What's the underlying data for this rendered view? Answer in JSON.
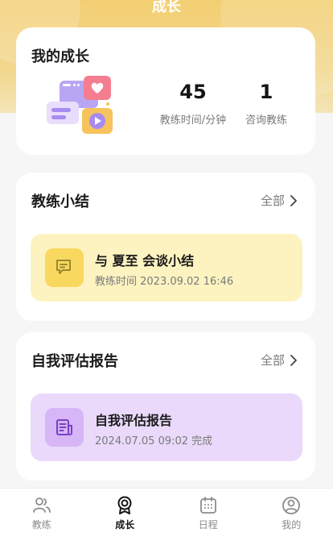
{
  "header": {
    "title": "成长"
  },
  "growth": {
    "title": "我的成长",
    "stats": [
      {
        "value": "45",
        "label": "教练时间/分钟"
      },
      {
        "value": "1",
        "label": "咨询教练"
      }
    ]
  },
  "summary": {
    "title": "教练小结",
    "view_all": "全部",
    "item": {
      "title": "与 夏至 会谈小结",
      "subtitle": "教练时间 2023.09.02 16:46"
    }
  },
  "report": {
    "title": "自我评估报告",
    "view_all": "全部",
    "item": {
      "title": "自我评估报告",
      "subtitle": "2024.07.05 09:02 完成"
    }
  },
  "tabbar": {
    "items": [
      {
        "label": "教练",
        "icon": "people-icon",
        "active": false
      },
      {
        "label": "成长",
        "icon": "growth-icon",
        "active": true
      },
      {
        "label": "日程",
        "icon": "calendar-icon",
        "active": false
      },
      {
        "label": "我的",
        "icon": "profile-icon",
        "active": false
      }
    ]
  },
  "colors": {
    "hero": "#f3cf72",
    "summary_bg": "#fdf3c0",
    "report_bg": "#ead9fb",
    "summary_icon": "#f9d860",
    "report_icon": "#d6b6f6"
  }
}
